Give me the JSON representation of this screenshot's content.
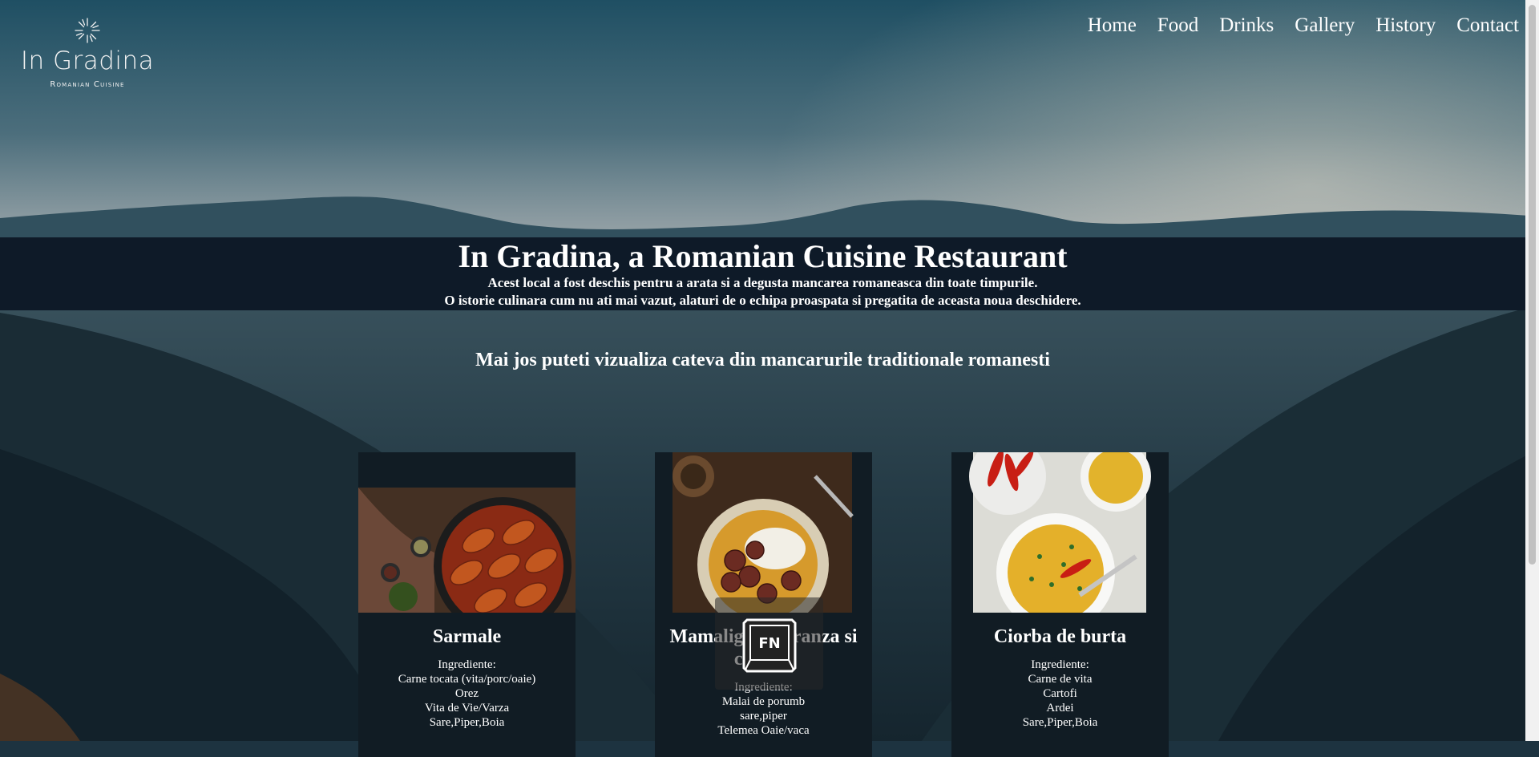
{
  "logo": {
    "name": "In Gradina",
    "subtitle": "Romanian Cuisine",
    "icon": "sun-rays-icon"
  },
  "nav": [
    {
      "label": "Home"
    },
    {
      "label": "Food"
    },
    {
      "label": "Drinks"
    },
    {
      "label": "Gallery"
    },
    {
      "label": "History"
    },
    {
      "label": "Contact"
    }
  ],
  "hero": {
    "title": "In Gradina, a Romanian Cuisine Restaurant",
    "line1": "Acest local a fost deschis pentru a arata si a degusta mancarea romaneasca din toate timpurile.",
    "line2": "O istorie culinara cum nu ati mai vazut, alaturi de o echipa proaspata si pregatita de aceasta noua deschidere."
  },
  "section_title": "Mai jos puteti vizualiza cateva din mancarurile traditionale romanesti",
  "cards": [
    {
      "title": "Sarmale",
      "ingredients_label": "Ingrediente:",
      "ingredients": [
        "Carne tocata (vita/porc/oaie)",
        "Orez",
        "Vita de Vie/Varza",
        "Sare,Piper,Boia"
      ]
    },
    {
      "title": "Mamaliga cu branza si carnati",
      "ingredients_label": "Ingrediente:",
      "ingredients": [
        "Malai de porumb",
        "sare,piper",
        "Telemea Oaie/vaca"
      ]
    },
    {
      "title": "Ciorba de burta",
      "ingredients_label": "Ingrediente:",
      "ingredients": [
        "Carne de vita",
        "Cartofi",
        "Ardei",
        "Sare,Piper,Boia"
      ]
    }
  ],
  "overlay": {
    "key_label": "FN",
    "icon": "keyboard-key-icon"
  },
  "colors": {
    "hero_band": "#0e1a28",
    "card_bg": "#111c24",
    "text": "#ffffff"
  }
}
